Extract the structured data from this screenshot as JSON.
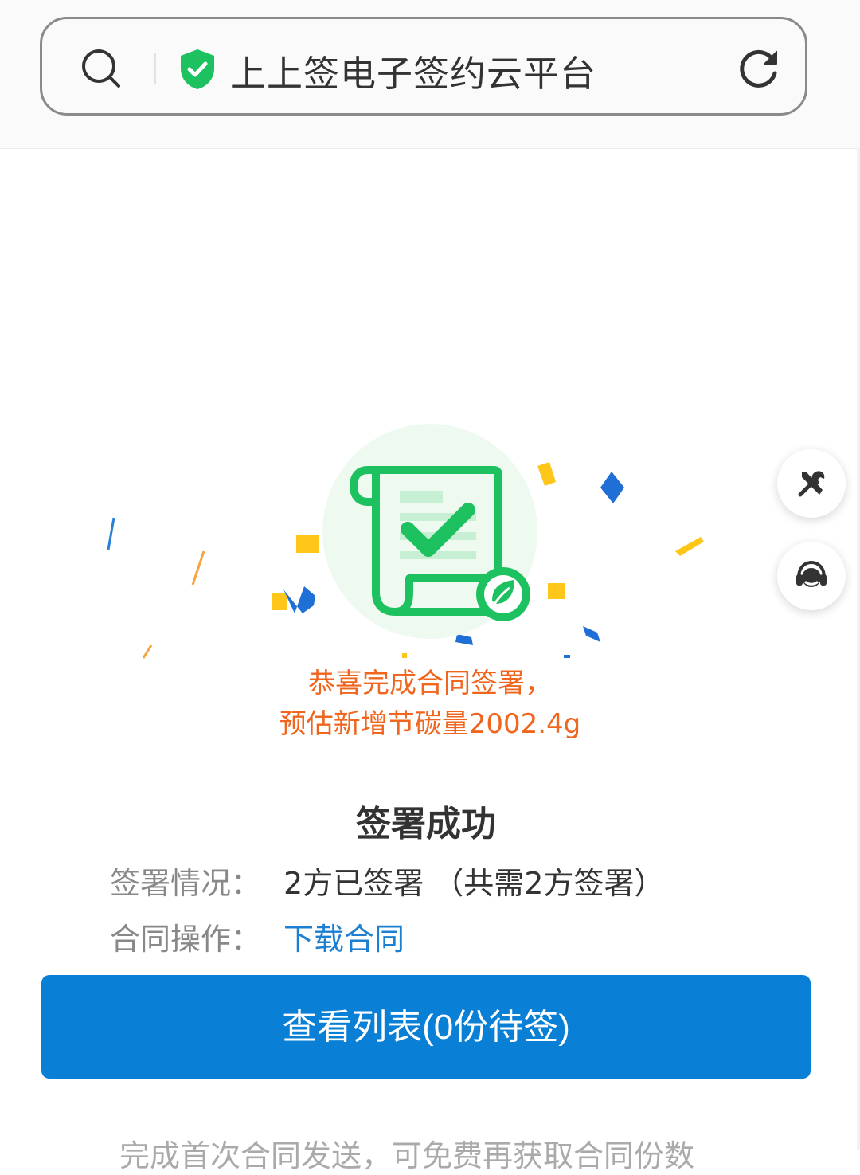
{
  "browser": {
    "title": "上上签电子签约云平台"
  },
  "colors": {
    "accent_green": "#1ec15f",
    "congrats_orange": "#f0661e",
    "link_blue": "#1b7fd2",
    "button_blue": "#0a7fd6"
  },
  "icons": {
    "search": "search-icon",
    "secure": "shield-check-icon",
    "reload": "refresh-icon",
    "tools": "tools-icon",
    "support": "headset-icon",
    "document": "signed-contract-icon",
    "eco": "leaf-icon"
  },
  "congrats": {
    "line1": "恭喜完成合同签署，",
    "line2": "预估新增节碳量2002.4g"
  },
  "result": {
    "title": "签署成功",
    "status_label": "签署情况：",
    "status_value": "2方已签署 （共需2方签署）",
    "action_label": "合同操作：",
    "action_link": "下载合同"
  },
  "primary_button": {
    "label": "查看列表(0份待签)"
  },
  "footer_note": "完成首次合同发送，可免费再获取合同份数"
}
